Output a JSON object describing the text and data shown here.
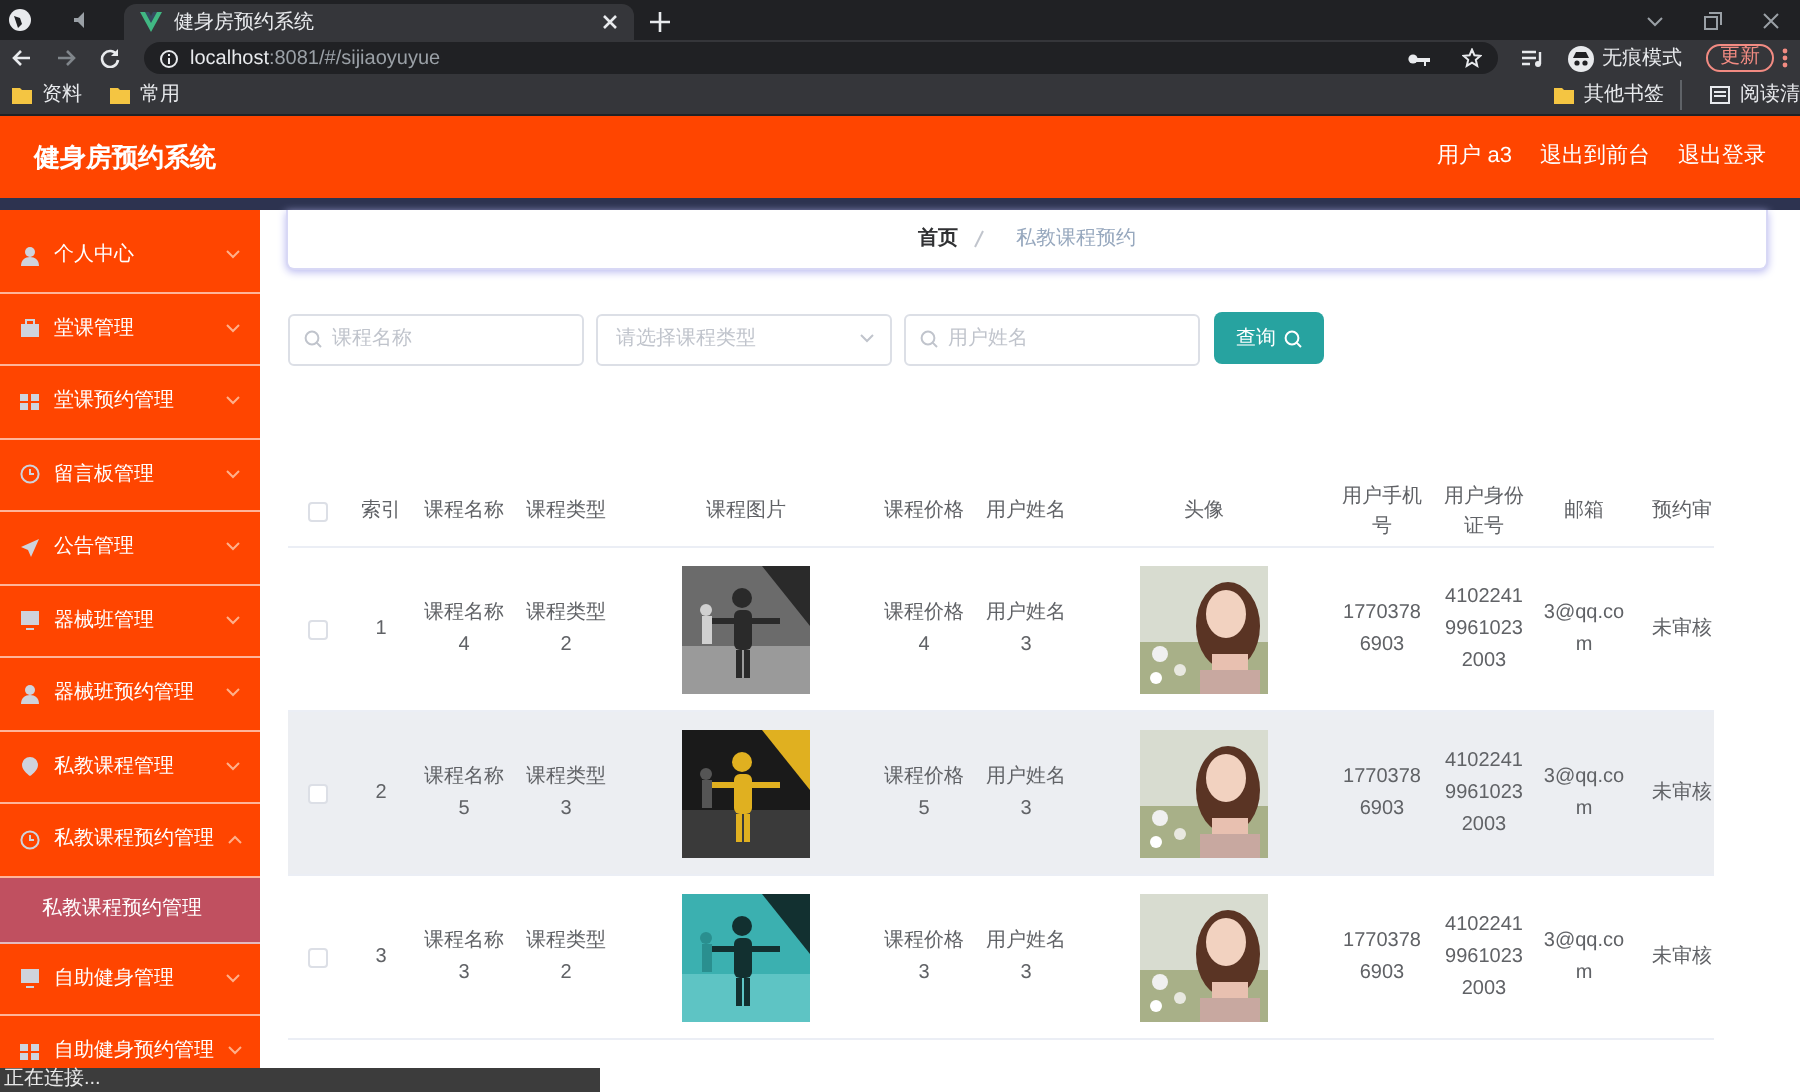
{
  "browser": {
    "tab_title": "健身房预约系统",
    "url_host": "localhost",
    "url_rest": ":8081/#/sijiaoyuyue",
    "incognito_label": "无痕模式",
    "update_button": "更新",
    "bookmarks": [
      "资料",
      "常用"
    ],
    "bookmarks_right": [
      {
        "kind": "folder",
        "label": "其他书签"
      },
      {
        "kind": "reading",
        "label": "阅读清"
      }
    ]
  },
  "header": {
    "title": "健身房预约系统",
    "links": [
      "用户 a3",
      "退出到前台",
      "退出登录"
    ]
  },
  "sidebar": {
    "items": [
      {
        "label": "个人中心",
        "expanded": false
      },
      {
        "label": "堂课管理",
        "expanded": false
      },
      {
        "label": "堂课预约管理",
        "expanded": false
      },
      {
        "label": "留言板管理",
        "expanded": false
      },
      {
        "label": "公告管理",
        "expanded": false
      },
      {
        "label": "器械班管理",
        "expanded": false
      },
      {
        "label": "器械班预约管理",
        "expanded": false
      },
      {
        "label": "私教课程管理",
        "expanded": false
      },
      {
        "label": "私教课程预约管理",
        "expanded": true,
        "children": [
          {
            "label": "私教课程预约管理",
            "selected": true
          }
        ]
      },
      {
        "label": "自助健身管理",
        "expanded": false
      },
      {
        "label": "自助健身预约管理",
        "expanded": false
      }
    ]
  },
  "breadcrumb": [
    "首页",
    "私教课程预约"
  ],
  "search": {
    "fields": [
      {
        "kind": "text",
        "placeholder": "课程名称"
      },
      {
        "kind": "select",
        "placeholder": "请选择课程类型"
      },
      {
        "kind": "text",
        "placeholder": "用户姓名"
      }
    ],
    "button": "查询"
  },
  "table": {
    "header_checked": false,
    "columns": [
      {
        "kind": "check"
      },
      {
        "kind": "text",
        "label": "索引"
      },
      {
        "kind": "text",
        "label": "课程名称"
      },
      {
        "kind": "text",
        "label": "课程类型"
      },
      {
        "kind": "picture",
        "label": "课程图片"
      },
      {
        "kind": "text",
        "label": "课程价格"
      },
      {
        "kind": "text",
        "label": "用户姓名"
      },
      {
        "kind": "picture",
        "label": "头像"
      },
      {
        "kind": "text",
        "label": "用户手机号"
      },
      {
        "kind": "text",
        "label": "用户身份证号"
      },
      {
        "kind": "text",
        "label": "邮箱"
      },
      {
        "kind": "text",
        "label": "预约审"
      }
    ],
    "rows": [
      {
        "hovered": false,
        "cells": [
          {
            "checked": false
          },
          "1",
          "课程名称4",
          "课程类型2",
          {
            "kind": "picture"
          },
          "课程价格4",
          "用户姓名3",
          {
            "kind": "picture"
          },
          "17703786903",
          "410224199610232003",
          "3@qq.com",
          "未审核"
        ]
      },
      {
        "hovered": true,
        "cells": [
          {
            "checked": false
          },
          "2",
          "课程名称5",
          "课程类型3",
          {
            "kind": "picture"
          },
          "课程价格5",
          "用户姓名3",
          {
            "kind": "picture"
          },
          "17703786903",
          "410224199610232003",
          "3@qq.com",
          "未审核"
        ]
      },
      {
        "hovered": false,
        "cells": [
          {
            "checked": false
          },
          "3",
          "课程名称3",
          "课程类型2",
          {
            "kind": "picture"
          },
          "课程价格3",
          "用户姓名3",
          {
            "kind": "picture"
          },
          "17703786903",
          "410224199610232003",
          "3@qq.com",
          "未审核"
        ]
      }
    ]
  },
  "status_text": "正在连接..."
}
